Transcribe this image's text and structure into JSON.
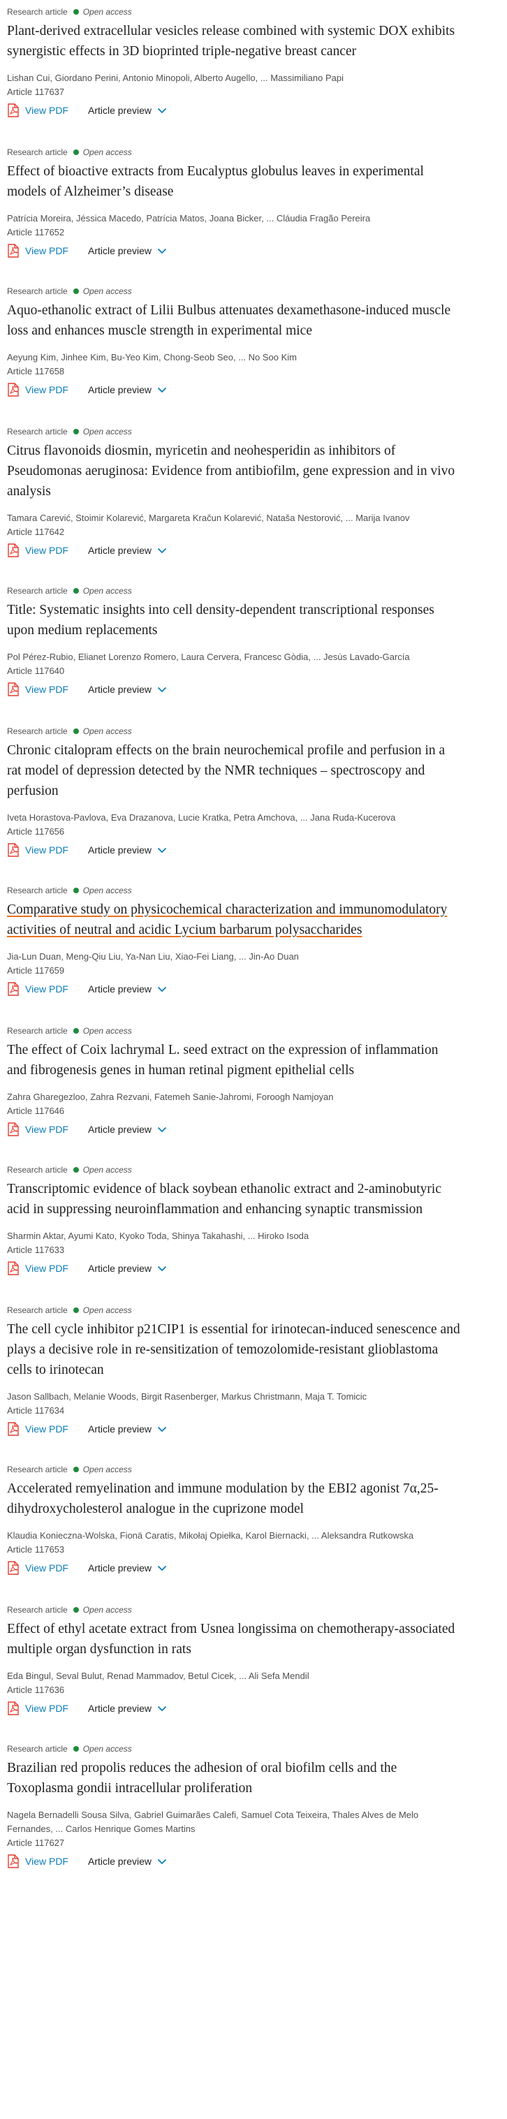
{
  "articles": [
    {
      "type": "Research article",
      "access": "Open access",
      "title_lines": [
        "Plant-derived extracellular vesicles release combined with systemic DOX exhibits",
        "synergistic effects in 3D bioprinted triple-negative breast cancer"
      ],
      "authors_lines": [
        "Lishan Cui, Giordano Perini, Antonio Minopoli, Alberto Augello, ... Massimiliano Papi"
      ],
      "article_number": "Article 117637",
      "pdf_label": "View PDF",
      "preview_label": "Article preview"
    },
    {
      "type": "Research article",
      "access": "Open access",
      "title_lines": [
        "Effect of bioactive extracts from Eucalyptus globulus leaves in experimental",
        "models of Alzheimer’s disease"
      ],
      "authors_lines": [
        "Patrícia Moreira, Jéssica Macedo, Patrícia Matos, Joana Bicker, ... Cláudia Fragão Pereira"
      ],
      "article_number": "Article 117652",
      "pdf_label": "View PDF",
      "preview_label": "Article preview"
    },
    {
      "type": "Research article",
      "access": "Open access",
      "title_lines": [
        "Aquo-ethanolic extract of Lilii Bulbus attenuates dexamethasone-induced muscle",
        "loss and enhances muscle strength in experimental mice"
      ],
      "authors_lines": [
        "Aeyung Kim, Jinhee Kim, Bu-Yeo Kim, Chong-Seob Seo, ... No Soo Kim"
      ],
      "article_number": "Article 117658",
      "pdf_label": "View PDF",
      "preview_label": "Article preview"
    },
    {
      "type": "Research article",
      "access": "Open access",
      "title_lines": [
        "Citrus flavonoids diosmin, myricetin and neohesperidin as inhibitors of",
        "Pseudomonas aeruginosa: Evidence from antibiofilm, gene expression and in vivo",
        "analysis"
      ],
      "authors_lines": [
        "Tamara Carević, Stoimir Kolarević, Margareta Kračun Kolarević, Nataša Nestorović, ... Marija Ivanov"
      ],
      "article_number": "Article 117642",
      "pdf_label": "View PDF",
      "preview_label": "Article preview"
    },
    {
      "type": "Research article",
      "access": "Open access",
      "title_lines": [
        "Title: Systematic insights into cell density-dependent transcriptional responses",
        "upon medium replacements"
      ],
      "authors_lines": [
        "Pol Pérez-Rubio, Elianet Lorenzo Romero, Laura Cervera, Francesc Gòdia, ... Jesús Lavado-García"
      ],
      "article_number": "Article 117640",
      "pdf_label": "View PDF",
      "preview_label": "Article preview"
    },
    {
      "type": "Research article",
      "access": "Open access",
      "title_lines": [
        "Chronic citalopram effects on the brain neurochemical profile and perfusion in a",
        "rat model of depression detected by the NMR techniques – spectroscopy and",
        "perfusion"
      ],
      "authors_lines": [
        "Iveta Horastova-Pavlova, Eva Drazanova, Lucie Kratka, Petra Amchova, ... Jana Ruda-Kucerova"
      ],
      "article_number": "Article 117656",
      "pdf_label": "View PDF",
      "preview_label": "Article preview"
    },
    {
      "type": "Research article",
      "access": "Open access",
      "title_lines": [
        "Comparative study on physicochemical characterization and immunomodulatory",
        "activities of neutral and acidic Lycium barbarum polysaccharides"
      ],
      "authors_lines": [
        "Jia-Lun Duan, Meng-Qiu Liu, Ya-Nan Liu, Xiao-Fei Liang, ... Jin-Ao Duan"
      ],
      "article_number": "Article 117659",
      "pdf_label": "View PDF",
      "preview_label": "Article preview"
    },
    {
      "type": "Research article",
      "access": "Open access",
      "title_lines": [
        "The effect of Coix lachrymal L. seed extract on the expression of inflammation",
        "and fibrogenesis genes in human retinal pigment epithelial cells"
      ],
      "authors_lines": [
        "Zahra Gharegezloo, Zahra Rezvani, Fatemeh Sanie-Jahromi, Foroogh Namjoyan"
      ],
      "article_number": "Article 117646",
      "pdf_label": "View PDF",
      "preview_label": "Article preview"
    },
    {
      "type": "Research article",
      "access": "Open access",
      "title_lines": [
        "Transcriptomic evidence of black soybean ethanolic extract and 2-aminobutyric",
        "acid in suppressing neuroinflammation and enhancing synaptic transmission"
      ],
      "authors_lines": [
        "Sharmin Aktar, Ayumi Kato, Kyoko Toda, Shinya Takahashi, ... Hiroko Isoda"
      ],
      "article_number": "Article 117633",
      "pdf_label": "View PDF",
      "preview_label": "Article preview"
    },
    {
      "type": "Research article",
      "access": "Open access",
      "title_lines": [
        "The cell cycle inhibitor p21CIP1 is essential for irinotecan-induced senescence and",
        "plays a decisive role in re-sensitization of temozolomide-resistant glioblastoma",
        "cells to irinotecan"
      ],
      "authors_lines": [
        "Jason Sallbach, Melanie Woods, Birgit Rasenberger, Markus Christmann, Maja T. Tomicic"
      ],
      "article_number": "Article 117634",
      "pdf_label": "View PDF",
      "preview_label": "Article preview"
    },
    {
      "type": "Research article",
      "access": "Open access",
      "title_lines": [
        "Accelerated remyelination and immune modulation by the EBI2 agonist 7α,25-",
        "dihydroxycholesterol analogue in the cuprizone model"
      ],
      "authors_lines": [
        "Klaudia Konieczna-Wolska, Fionä Caratis, Mikołaj Opiełka, Karol Biernacki, ... Aleksandra Rutkowska"
      ],
      "article_number": "Article 117653",
      "pdf_label": "View PDF",
      "preview_label": "Article preview"
    },
    {
      "type": "Research article",
      "access": "Open access",
      "title_lines": [
        "Effect of ethyl acetate extract from Usnea longissima on chemotherapy-associated",
        "multiple organ dysfunction in rats"
      ],
      "authors_lines": [
        "Eda Bingul, Seval Bulut, Renad Mammadov, Betul Cicek, ... Ali Sefa Mendil"
      ],
      "article_number": "Article 117636",
      "pdf_label": "View PDF",
      "preview_label": "Article preview"
    },
    {
      "type": "Research article",
      "access": "Open access",
      "title_lines": [
        "Brazilian red propolis reduces the adhesion of oral biofilm cells and the",
        "Toxoplasma gondii intracellular proliferation"
      ],
      "authors_lines": [
        "Nagela Bernadelli Sousa Silva, Gabriel Guimarães Calefi, Samuel Cota Teixeira, Thales Alves de Melo",
        "Fernandes, ... Carlos Henrique Gomes Martins"
      ],
      "article_number": "Article 117627",
      "pdf_label": "View PDF",
      "preview_label": "Article preview"
    }
  ]
}
